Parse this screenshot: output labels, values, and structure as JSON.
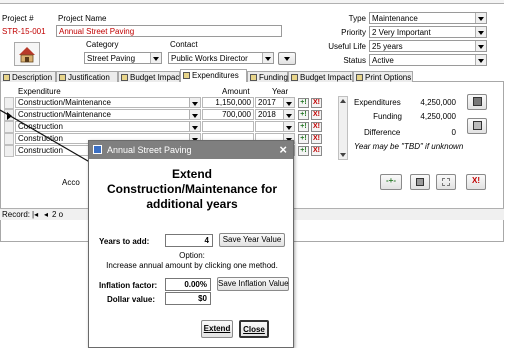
{
  "header": {
    "project_number_label": "Project #",
    "project_number_value": "STR-15-001",
    "project_name_label": "Project Name",
    "project_name_value": "Annual Street Paving",
    "category_label": "Category",
    "category_value": "Street Paving",
    "contact_label": "Contact",
    "contact_value": "Public Works Director",
    "type_label": "Type",
    "type_value": "Maintenance",
    "priority_label": "Priority",
    "priority_value": "2 Very Important",
    "useful_life_label": "Useful Life",
    "useful_life_value": "25 years",
    "status_label": "Status",
    "status_value": "Active"
  },
  "tabs": [
    {
      "label": "Description",
      "active": false
    },
    {
      "label": "Justification",
      "active": false
    },
    {
      "label": "Budget Impact",
      "active": false
    },
    {
      "label": "Expenditures",
      "active": true
    },
    {
      "label": "Funding",
      "active": false
    },
    {
      "label": "Budget Impact",
      "active": false
    },
    {
      "label": "Print Options",
      "active": false
    }
  ],
  "grid": {
    "col_expenditure": "Expenditure",
    "col_amount": "Amount",
    "col_year": "Year",
    "rows": [
      {
        "expenditure": "Construction/Maintenance",
        "amount": "1,150,000",
        "year": "2017"
      },
      {
        "expenditure": "Construction/Maintenance",
        "amount": "700,000",
        "year": "2018"
      },
      {
        "expenditure": "Construction",
        "amount": "",
        "year": ""
      },
      {
        "expenditure": "Construction",
        "amount": "",
        "year": ""
      },
      {
        "expenditure": "Construction",
        "amount": "",
        "year": ""
      }
    ]
  },
  "summary": {
    "expenditures_label": "Expenditures",
    "expenditures_value": "4,250,000",
    "funding_label": "Funding",
    "funding_value": "4,250,000",
    "difference_label": "Difference",
    "difference_value": "0",
    "note": "Year may be \"TBD\" if unknown"
  },
  "footer": {
    "acco_label": "Acco",
    "record_label": "Record:",
    "record_value": "2 o"
  },
  "dialog": {
    "title": "Annual Street Paving",
    "heading": "Extend Construction/Maintenance for additional years",
    "years_label": "Years to add:",
    "years_value": "4",
    "save_year_label": "Save Year Value",
    "option_label": "Option:",
    "option_text": "Increase annual amount by clicking one method.",
    "inflation_label": "Inflation factor:",
    "inflation_value": "0.00%",
    "save_inflation_label": "Save Inflation Value",
    "dollar_label": "Dollar value:",
    "dollar_value": "$0",
    "extend_label": "Extend",
    "close_label": "Close"
  },
  "icons": {
    "row_add": "+!",
    "row_delete": "X!",
    "toolbar_add": "-+-",
    "toolbar_delete": "X!"
  },
  "colors": {
    "dialog_titlebar": "#7f7f7f",
    "accent_red": "#c00000",
    "add_green": "#2a7a2a"
  }
}
